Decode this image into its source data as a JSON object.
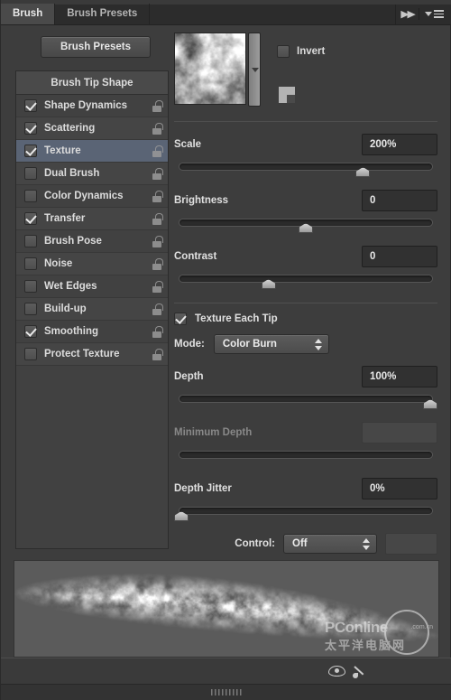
{
  "window": {
    "tabs": [
      {
        "label": "Brush",
        "active": true
      },
      {
        "label": "Brush Presets",
        "active": false
      }
    ],
    "collapse_icon": "▶▶",
    "menu_icon": "panel-menu-icon"
  },
  "toolbar": {
    "presets_button": "Brush Presets"
  },
  "sidebar": {
    "header": "Brush Tip Shape",
    "items": [
      {
        "label": "Shape Dynamics",
        "checked": true,
        "selected": false,
        "lock": "unlocked-icon"
      },
      {
        "label": "Scattering",
        "checked": true,
        "selected": false,
        "lock": "unlocked-icon"
      },
      {
        "label": "Texture",
        "checked": true,
        "selected": true,
        "lock": "unlocked-icon"
      },
      {
        "label": "Dual Brush",
        "checked": false,
        "selected": false,
        "lock": "unlocked-icon"
      },
      {
        "label": "Color Dynamics",
        "checked": false,
        "selected": false,
        "lock": "unlocked-icon"
      },
      {
        "label": "Transfer",
        "checked": true,
        "selected": false,
        "lock": "unlocked-icon"
      },
      {
        "label": "Brush Pose",
        "checked": false,
        "selected": false,
        "lock": "unlocked-icon"
      },
      {
        "label": "Noise",
        "checked": false,
        "selected": false,
        "lock": "unlocked-icon"
      },
      {
        "label": "Wet Edges",
        "checked": false,
        "selected": false,
        "lock": "unlocked-icon"
      },
      {
        "label": "Build-up",
        "checked": false,
        "selected": false,
        "lock": "unlocked-icon"
      },
      {
        "label": "Smoothing",
        "checked": true,
        "selected": false,
        "lock": "unlocked-icon"
      },
      {
        "label": "Protect Texture",
        "checked": false,
        "selected": false,
        "lock": "unlocked-icon"
      }
    ]
  },
  "texture": {
    "thumbnail_name": "texture-swatch",
    "picker_arrow": "chevron-down-icon",
    "invert_label": "Invert",
    "invert_checked": false,
    "new_texture_icon": "new-texture-icon"
  },
  "controls": {
    "scale": {
      "label": "Scale",
      "value": "200%",
      "slider_pct": 73,
      "enabled": true
    },
    "brightness": {
      "label": "Brightness",
      "value": "0",
      "slider_pct": 50,
      "enabled": true
    },
    "contrast": {
      "label": "Contrast",
      "value": "0",
      "slider_pct": 35,
      "enabled": true
    },
    "texture_each_tip": {
      "label": "Texture Each Tip",
      "checked": true
    },
    "mode": {
      "label": "Mode:",
      "value": "Color Burn"
    },
    "depth": {
      "label": "Depth",
      "value": "100%",
      "slider_pct": 100,
      "enabled": true
    },
    "minimum_depth": {
      "label": "Minimum Depth",
      "value": "",
      "slider_pct": 0,
      "enabled": false
    },
    "depth_jitter": {
      "label": "Depth Jitter",
      "value": "0%",
      "slider_pct": 0,
      "enabled": true
    },
    "control": {
      "label": "Control:",
      "value": "Off",
      "extra_value": ""
    }
  },
  "preview": {
    "name": "brush-stroke-preview",
    "watermark_main": "PConline",
    "watermark_sub": ".com.cn",
    "watermark_cn": "太平洋电脑网"
  },
  "statusbar": {
    "eye_icon": "eye-icon",
    "brush_icon": "brush-icon",
    "resize_grip": "resize-grip"
  },
  "colors": {
    "panel_bg": "#3d3d3d",
    "list_bg": "#414141",
    "selected_row": "#5a6475",
    "tab_active": "#4a4a4a",
    "text": "#dcdcdc",
    "field_bg": "#313131"
  }
}
